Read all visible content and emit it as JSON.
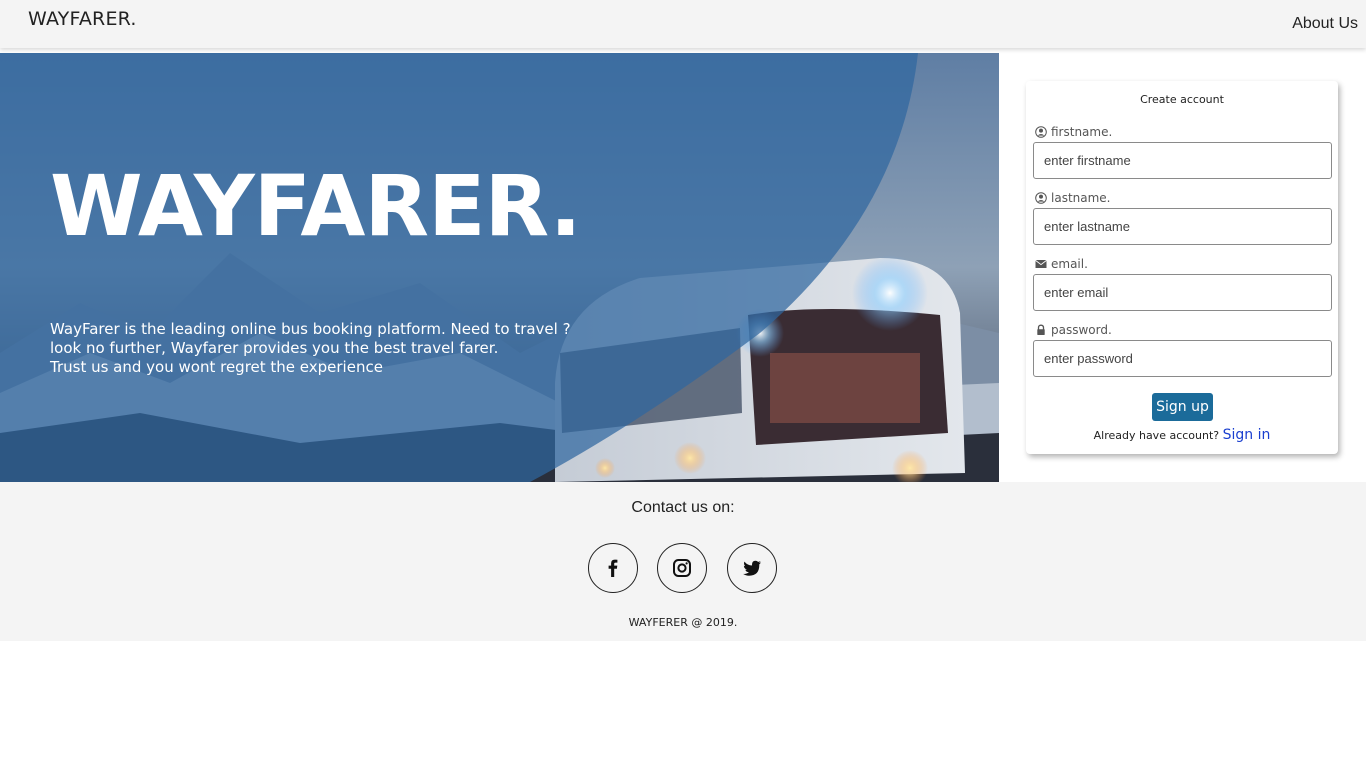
{
  "navbar": {
    "brand": "WAYFARER.",
    "about_link": "About Us"
  },
  "hero": {
    "title": "WAYFARER.",
    "lines": [
      "WayFarer is the leading online bus booking platform. Need to travel ?",
      "look no further, Wayfarer provides you the best travel farer.",
      "Trust us and you wont regret the experience"
    ]
  },
  "signup": {
    "title": "Create account",
    "fields": [
      {
        "label": "firstname.",
        "placeholder": "enter firstname",
        "icon": "user-circle-icon"
      },
      {
        "label": "lastname.",
        "placeholder": "enter lastname",
        "icon": "user-circle-icon"
      },
      {
        "label": "email.",
        "placeholder": "enter email",
        "icon": "envelope-icon"
      },
      {
        "label": "password.",
        "placeholder": "enter password",
        "icon": "lock-icon"
      }
    ],
    "submit_label": "Sign up",
    "signin_prompt": "Already have account?",
    "signin_link": "Sign in"
  },
  "footer": {
    "contact_title": "Contact us on:",
    "socials": [
      "facebook-icon",
      "instagram-icon",
      "twitter-icon"
    ],
    "copyright": "WAYFERER @ 2019."
  },
  "colors": {
    "navbar_bg": "#f4f4f4",
    "footer_bg": "#f4f4f4",
    "button_bg": "#1b6b9a",
    "link": "#1a3fcf"
  }
}
